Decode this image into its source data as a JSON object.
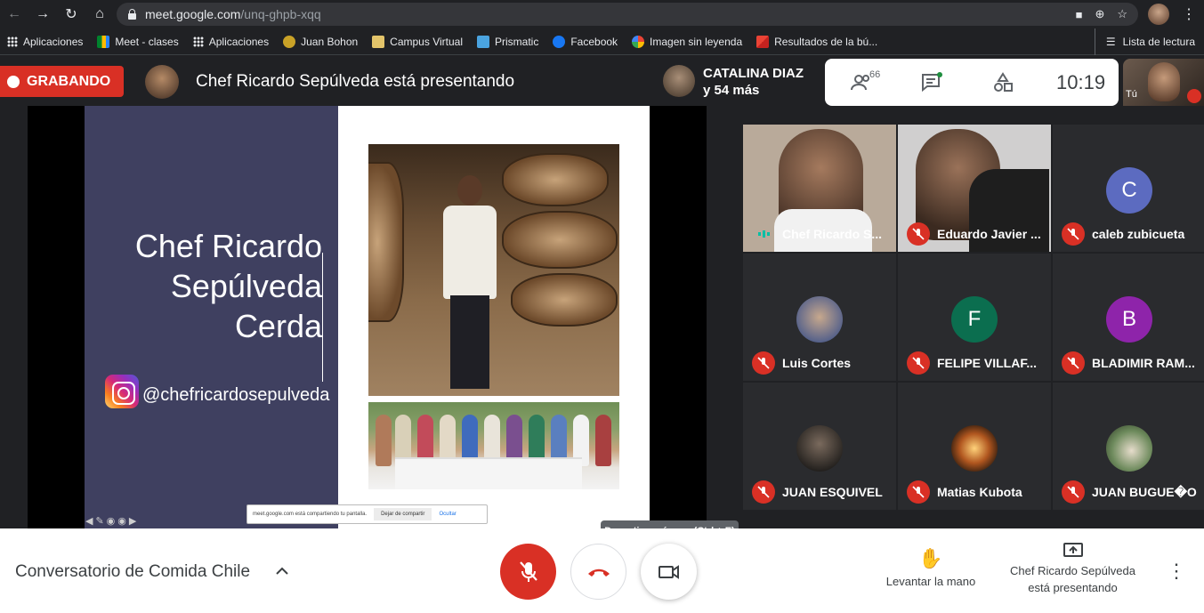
{
  "browser": {
    "url_domain": "meet.google.com",
    "url_path": "/unq-ghpb-xqq",
    "bookmarks": [
      {
        "label": "Aplicaciones",
        "icon": "apps-icon"
      },
      {
        "label": "Meet - clases",
        "icon": "meet-icon"
      },
      {
        "label": "Aplicaciones",
        "icon": "apps-icon"
      },
      {
        "label": "Juan Bohon",
        "icon": "bookmark-icon"
      },
      {
        "label": "Campus Virtual",
        "icon": "bookmark-icon"
      },
      {
        "label": "Prismatic",
        "icon": "bookmark-icon"
      },
      {
        "label": "Facebook",
        "icon": "facebook-icon"
      },
      {
        "label": "Imagen sin leyenda",
        "icon": "photos-icon"
      },
      {
        "label": "Resultados de la bú...",
        "icon": "gmail-icon"
      }
    ],
    "reading_list": "Lista de lectura"
  },
  "top": {
    "recording_label": "GRABANDO",
    "presenting_title": "Chef Ricardo Sepúlveda está presentando",
    "speaker_name": "CATALINA DIAZ",
    "speaker_more": "y 54 más",
    "people_count": "66",
    "clock": "10:19",
    "self_label": "Tú"
  },
  "slide": {
    "name_line1": "Chef Ricardo",
    "name_line2": "Sepúlveda",
    "name_line3": "Cerda",
    "instagram": "@chefricardosepulveda",
    "share_notice": "meet.google.com está compartiendo tu pantalla.",
    "share_stop": "Dejar de compartir",
    "share_hide": "Ocultar"
  },
  "tooltip": "Desactivar cámara (Ctrl + E)",
  "participants": [
    {
      "name": "Chef Ricardo S...",
      "type": "video",
      "muted": false,
      "color": "#8a6c56"
    },
    {
      "name": "Eduardo Javier ...",
      "type": "video",
      "muted": true,
      "color": "#6b5443"
    },
    {
      "name": "caleb zubicueta",
      "type": "letter",
      "letter": "C",
      "muted": true,
      "color": "#5c6bc0"
    },
    {
      "name": "Luis Cortes",
      "type": "photo",
      "muted": true,
      "color": "#9fa6c4"
    },
    {
      "name": "FELIPE VILLAF...",
      "type": "letter",
      "letter": "F",
      "muted": true,
      "color": "#0b6e4f"
    },
    {
      "name": "BLADIMIR RAM...",
      "type": "letter",
      "letter": "B",
      "muted": true,
      "color": "#8e24aa"
    },
    {
      "name": "JUAN ESQUIVEL",
      "type": "photo",
      "muted": true,
      "color": "#3d3a37"
    },
    {
      "name": "Matias Kubota",
      "type": "photo",
      "muted": true,
      "color": "#b0561f"
    },
    {
      "name": "JUAN BUGUE�O",
      "type": "photo",
      "muted": true,
      "color": "#6d8a5c"
    }
  ],
  "bottom": {
    "meeting_title": "Conversatorio de Comida Chile",
    "raise_hand": "Levantar la mano",
    "present_line1": "Chef Ricardo Sepúlveda",
    "present_line2": "está presentando"
  },
  "colors": {
    "accent_red": "#d93025",
    "meet_dark": "#202124"
  }
}
